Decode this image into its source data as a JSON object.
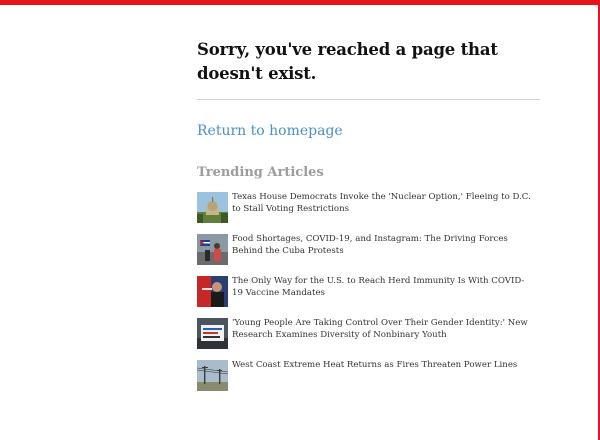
{
  "colors": {
    "brand_red": "#e8141d",
    "link_blue": "#4a90c8",
    "muted_heading": "#9c9c9c"
  },
  "page": {
    "headline": "Sorry, you've reached a page that doesn't exist.",
    "home_link": "Return to homepage",
    "trending_heading": "Trending Articles"
  },
  "trending": [
    {
      "title": "Texas House Democrats Invoke the 'Nuclear Option,' Fleeing to D.C. to Stall Voting Restrictions",
      "thumbnail": "texas-capitol-photo"
    },
    {
      "title": "Food Shortages, COVID-19, and Instagram: The Driving Forces Behind the Cuba Protests",
      "thumbnail": "cuba-protest-photo"
    },
    {
      "title": "The Only Way for the U.S. to Reach Herd Immunity Is With COVID-19 Vaccine Mandates",
      "thumbnail": "vaccine-photo"
    },
    {
      "title": "'Young People Are Taking Control Over Their Gender Identity:' New Research Examines Diversity of Nonbinary Youth",
      "thumbnail": "protest-sign-photo"
    },
    {
      "title": "West Coast Extreme Heat Returns as Fires Threaten Power Lines",
      "thumbnail": "power-lines-photo"
    }
  ]
}
